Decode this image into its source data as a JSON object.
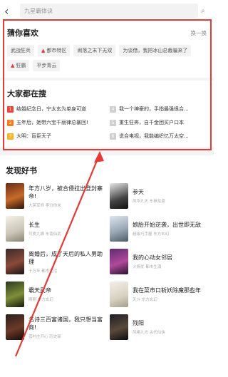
{
  "search": {
    "placeholder": "九星霸体诀"
  },
  "guess": {
    "title": "猜你喜欢",
    "refresh": "换一换",
    "tags": [
      {
        "label": "武战狂兵",
        "hot": false
      },
      {
        "label": "都市特区",
        "hot": true
      },
      {
        "label": "闹落之末下无双",
        "hot": false
      },
      {
        "label": "为谈借，我把冰山总裁骗来了",
        "hot": false
      },
      {
        "label": "狂霸",
        "hot": true
      },
      {
        "label": "平步青云",
        "hot": false
      }
    ]
  },
  "hot": {
    "title": "大家都在搜",
    "items": [
      {
        "rank": "1",
        "text": "结婚纪念日，宁太玄为单身可道"
      },
      {
        "rank": "4",
        "text": "我一个神豪的，手指最强很合..."
      },
      {
        "rank": "2",
        "text": "五年后，她带六宝千丽律总暴回!"
      },
      {
        "rank": "5",
        "text": "重生狂奔，自千金团买户口本"
      },
      {
        "rank": "3",
        "text": "大明：盲臣天子"
      },
      {
        "rank": "6",
        "text": "说合电视，我能编织忆万太空..."
      }
    ]
  },
  "discover": {
    "title": "发现好书",
    "books": [
      {
        "name": "年方八岁，被合侵拉出登封寨帝!",
        "meta": "大英军师 李分你米"
      },
      {
        "name": "参天",
        "meta": "风华九天 东神龙源"
      },
      {
        "name": "长生",
        "meta": "可爱九娘 东南仙武"
      },
      {
        "name": "娘胎开始逆袭，出世即无敌",
        "meta": "超级巧手屋 东方玄幻"
      },
      {
        "name": "离婚后，成了天后的私人男助理",
        "meta": "十万年 都市生活"
      },
      {
        "name": "我的心动女邻居",
        "meta": "火情优 都市生涌"
      },
      {
        "name": "霸天武帝",
        "meta": "刚刚 东方玄幻"
      },
      {
        "name": "我在菜市口斩妖除魔那些年",
        "meta": "天斗 东方玄幻"
      },
      {
        "name": "名诗三百富诸国，我只想当富商!",
        "meta": "农村庄开心 历史架"
      },
      {
        "name": "残阳",
        "meta": "风格九光 古代仙侠"
      }
    ]
  }
}
